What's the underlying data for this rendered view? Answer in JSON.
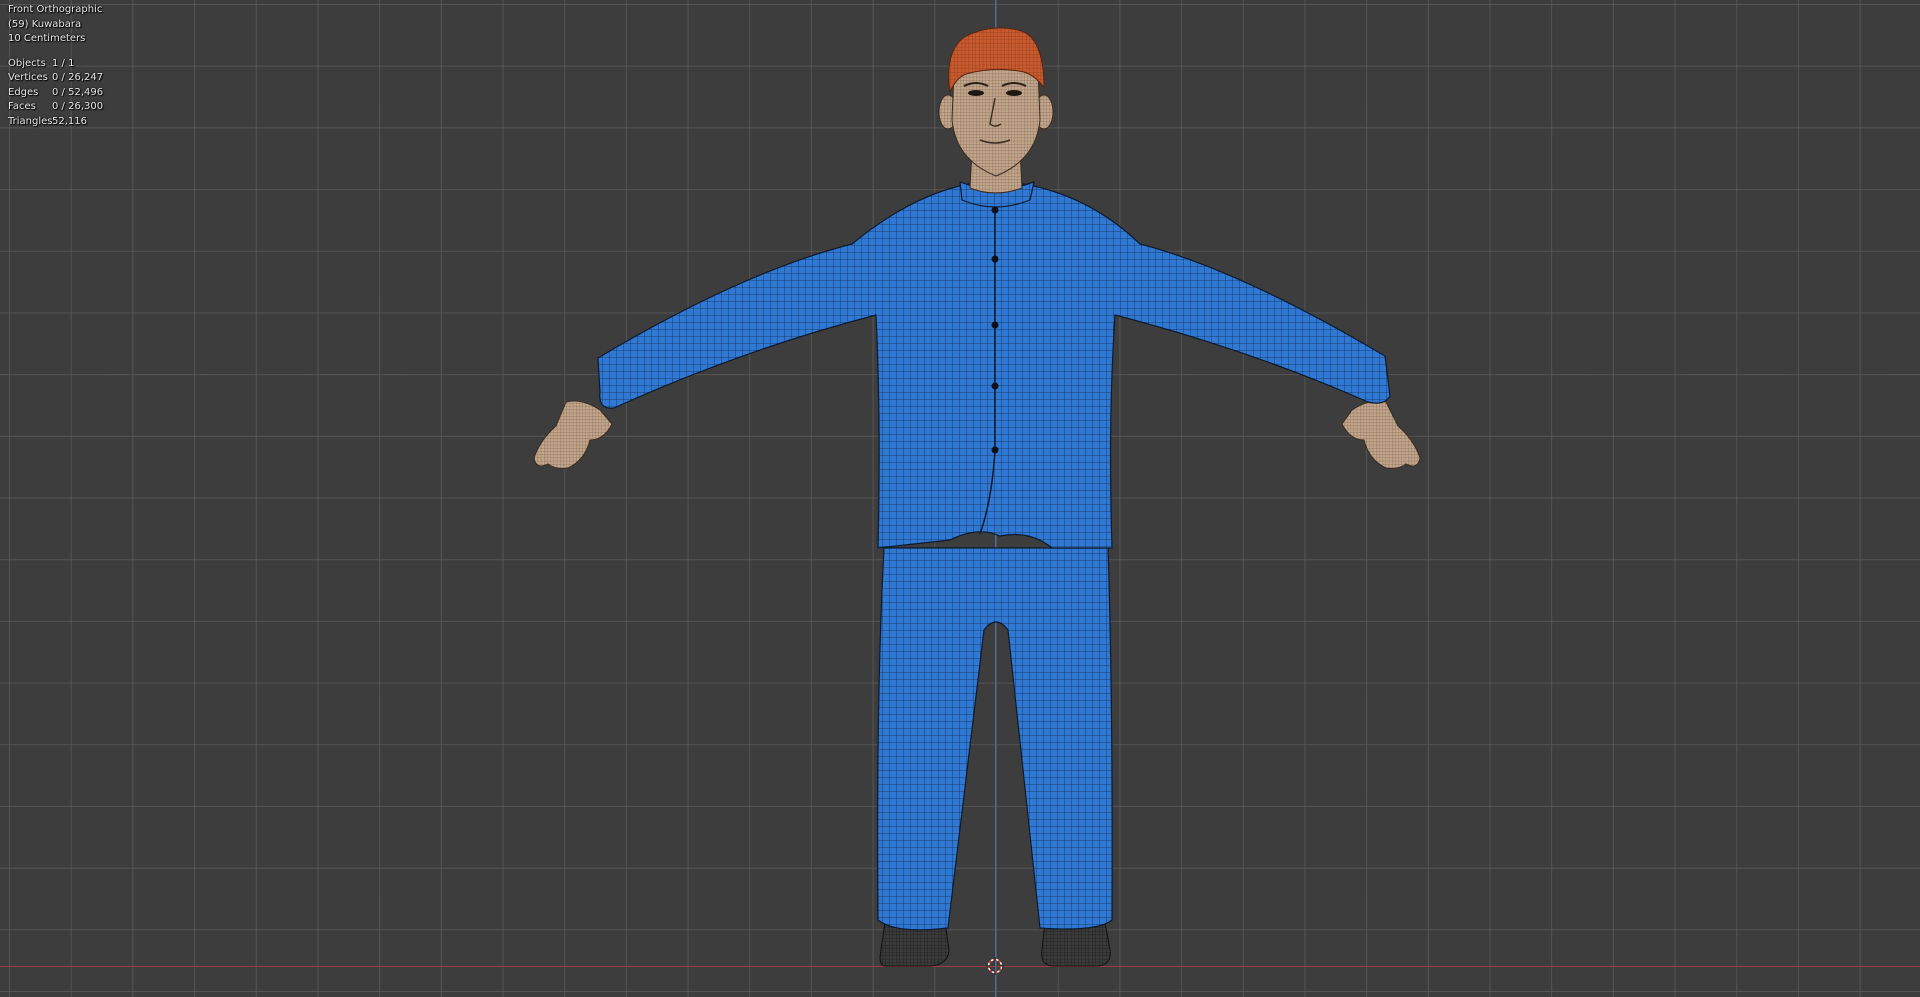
{
  "viewport": {
    "view_name": "Front Orthographic",
    "object_name": "(59) Kuwabara",
    "grid_scale": "10 Centimeters",
    "stats": [
      {
        "label": "Objects",
        "value": "1 / 1"
      },
      {
        "label": "Vertices",
        "value": "0 / 26,247"
      },
      {
        "label": "Edges",
        "value": "0 / 52,496"
      },
      {
        "label": "Faces",
        "value": "0 / 26,300"
      },
      {
        "label": "Triangles",
        "value": "52,116"
      }
    ]
  },
  "colors": {
    "background": "#3d3d3d",
    "grid_line": "#5c5c5c",
    "x_axis": "#9c3b40",
    "z_axis": "#3f6fa8",
    "suit": "#2f78d4",
    "skin": "#c2a58a",
    "hair": "#c85a2e",
    "shoes": "#3a3a3a",
    "wire": "#10213a"
  },
  "icons": {
    "origin_cursor": "3d-cursor-icon"
  }
}
